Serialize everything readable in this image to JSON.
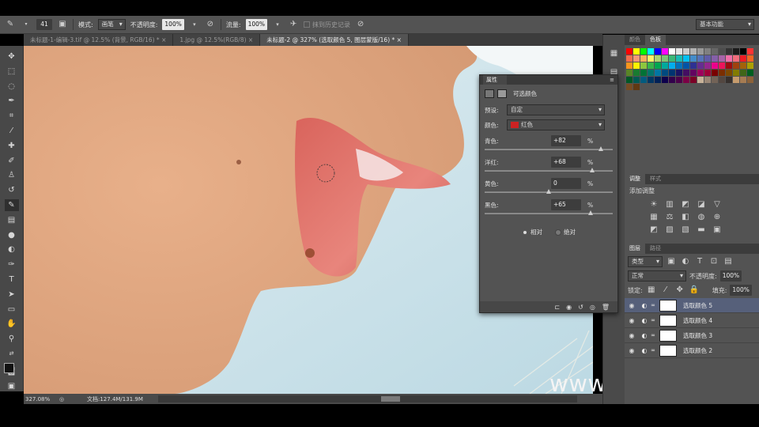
{
  "options": {
    "brush_size": "41",
    "mode_label": "模式:",
    "mode_value": "画笔",
    "opacity_label": "不透明度:",
    "opacity_value": "100%",
    "flow_label": "流量:",
    "flow_value": "100%",
    "history_label": "抹到历史记录",
    "workspace": "基本功能"
  },
  "tabs": [
    {
      "label": "未标题-1-编辑-3.tif @ 12.5% (背景, RGB/16) * ×",
      "active": false
    },
    {
      "label": "1.jpg @ 12.5%(RGB/8) ×",
      "active": false
    },
    {
      "label": "未标题-2 @ 327% (选取颜色 5, 图层蒙版/16) * ×",
      "active": true
    }
  ],
  "status": {
    "zoom": "327.08%",
    "doc": "文档:127.4M/131.9M"
  },
  "swatch_panel": {
    "tabs": [
      "颜色",
      "色板"
    ],
    "colors": [
      "#ff0000",
      "#ffff00",
      "#00ff00",
      "#00ffff",
      "#0000ff",
      "#ff00ff",
      "#ffffff",
      "#e5e5e5",
      "#cccccc",
      "#b3b3b3",
      "#999999",
      "#808080",
      "#666666",
      "#4d4d4d",
      "#333333",
      "#1a1a1a",
      "#000000",
      "#ff3333",
      "#f26c4f",
      "#f69679",
      "#fbaf5c",
      "#fff568",
      "#acd372",
      "#7cc576",
      "#3bb878",
      "#1abbb4",
      "#00bff3",
      "#438cca",
      "#5574b9",
      "#605ca8",
      "#855fa8",
      "#a763a8",
      "#f06ea9",
      "#f26d7d",
      "#ed1c24",
      "#f26522",
      "#f7941d",
      "#fff200",
      "#8dc63f",
      "#39b54a",
      "#00a651",
      "#00a99d",
      "#00aeef",
      "#0072bc",
      "#0054a6",
      "#2e3192",
      "#662d91",
      "#92278f",
      "#ec008c",
      "#ed145b",
      "#9e0b0f",
      "#a0410d",
      "#a3620a",
      "#aba000",
      "#598527",
      "#197b30",
      "#007236",
      "#00746b",
      "#0076a3",
      "#004a80",
      "#003471",
      "#1b1464",
      "#440e62",
      "#630460",
      "#9e005d",
      "#9e0039",
      "#790000",
      "#7b2e00",
      "#7d4900",
      "#827b00",
      "#406618",
      "#005e20",
      "#005826",
      "#005952",
      "#005b7f",
      "#003663",
      "#002157",
      "#0d004c",
      "#32004b",
      "#4b0049",
      "#7b0046",
      "#7a0026",
      "#c7b299",
      "#998675",
      "#736357",
      "#534741",
      "#37302d",
      "#c69c6d",
      "#a67c52",
      "#8c6239",
      "#754c24",
      "#603913"
    ]
  },
  "adjust_panel": {
    "tabs": [
      "调整",
      "样式"
    ],
    "title": "添加调整"
  },
  "layers_panel": {
    "tabs": [
      "图层",
      "路径"
    ],
    "filter": "类型",
    "blend": "正常",
    "opacity_label": "不透明度:",
    "opacity_value": "100%",
    "lock_label": "锁定:",
    "fill_label": "填充:",
    "fill_value": "100%",
    "layers": [
      {
        "name": "选取颜色 5",
        "selected": true
      },
      {
        "name": "选取颜色 4",
        "selected": false
      },
      {
        "name": "选取颜色 3",
        "selected": false
      },
      {
        "name": "选取颜色 2",
        "selected": false
      }
    ]
  },
  "properties": {
    "tab": "属性",
    "title": "可选颜色",
    "preset_label": "预设:",
    "preset_value": "自定",
    "colors_label": "颜色:",
    "colors_value": "红色",
    "sliders": [
      {
        "label": "青色:",
        "value": "+82",
        "pct": "%",
        "frac": 0.91
      },
      {
        "label": "洋红:",
        "value": "+68",
        "pct": "%",
        "frac": 0.84
      },
      {
        "label": "黄色:",
        "value": "0",
        "pct": "%",
        "frac": 0.5
      },
      {
        "label": "黑色:",
        "value": "+65",
        "pct": "%",
        "frac": 0.825
      }
    ],
    "relative": "相对",
    "absolute": "绝对"
  },
  "watermark": "www.hunls.com"
}
